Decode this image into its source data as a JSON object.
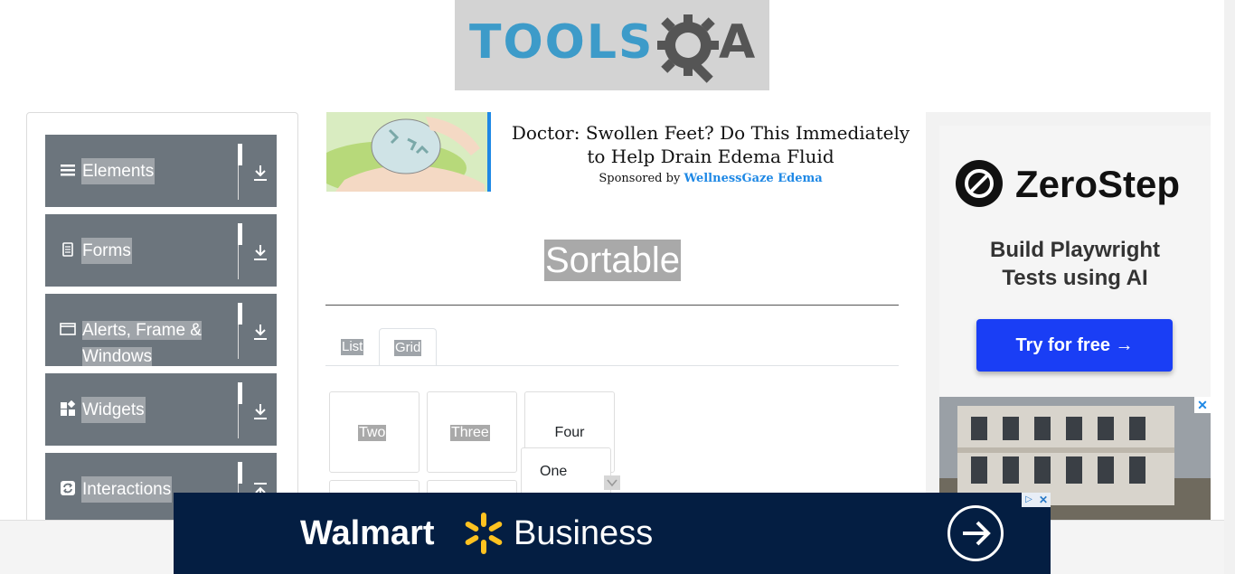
{
  "header": {
    "logo_text": "TOOLS",
    "logo_suffix": "A"
  },
  "sidebar": {
    "groups": [
      {
        "label": "Elements",
        "icon": "hamburger-icon",
        "expanded": false
      },
      {
        "label": "Forms",
        "icon": "document-icon",
        "expanded": false
      },
      {
        "label_line1": "Alerts, Frame &",
        "label_line2": "Windows",
        "icon": "window-icon",
        "expanded": false
      },
      {
        "label": "Widgets",
        "icon": "widgets-icon",
        "expanded": false
      },
      {
        "label": "Interactions",
        "icon": "interactions-icon",
        "expanded": true
      }
    ]
  },
  "ad_top": {
    "headline": "Doctor: Swollen Feet? Do This Immediately to Help Drain Edema Fluid",
    "sponsor_prefix": "Sponsored by",
    "sponsor_name": "WellnessGaze Edema",
    "accent_color": "#1e88e5"
  },
  "main": {
    "title": "Sortable",
    "tabs": [
      {
        "label": "List",
        "active": false
      },
      {
        "label": "Grid",
        "active": true
      }
    ],
    "grid_items": [
      "Two",
      "Three",
      "Four"
    ],
    "dragging_item": "One"
  },
  "ad_right": {
    "brand": "ZeroStep",
    "tagline_line1": "Build Playwright",
    "tagline_line2": "Tests using AI",
    "cta": "Try for free →",
    "cta_color": "#1a3ef5",
    "close_label": "✕"
  },
  "banner": {
    "brand": "Walmart",
    "product": "Business",
    "adchoice_label": "▷",
    "close_label": "✕",
    "background": "#041e42",
    "spark_color": "#ffc220"
  }
}
